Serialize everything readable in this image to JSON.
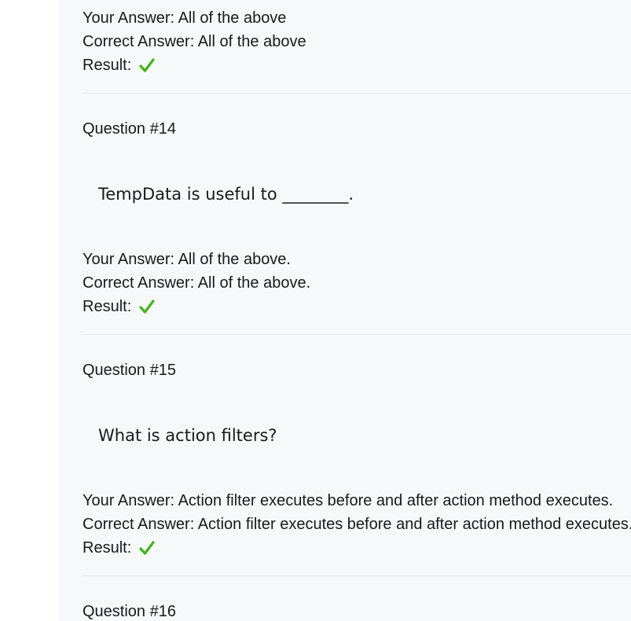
{
  "labels": {
    "your_answer": "Your Answer: ",
    "correct_answer": "Correct Answer: ",
    "result": "Result: "
  },
  "colors": {
    "check": "#3fb618",
    "panel_bg": "#f7f8fa"
  },
  "items": [
    {
      "your_answer": "All of the above",
      "correct_answer": "All of the above",
      "result_icon": "checkmark-icon"
    },
    {
      "heading": "Question #14",
      "question": "TempData is useful to ________.",
      "your_answer": "All of the above.",
      "correct_answer": "All of the above.",
      "result_icon": "checkmark-icon"
    },
    {
      "heading": "Question #15",
      "question": "What is action filters?",
      "your_answer": "Action filter executes before and after action method executes.",
      "correct_answer": "Action filter executes before and after action method executes.",
      "result_icon": "checkmark-icon"
    },
    {
      "heading": "Question #16"
    }
  ]
}
